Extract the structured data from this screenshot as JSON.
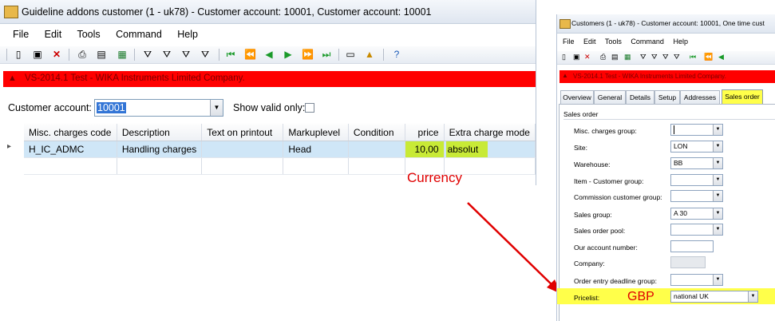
{
  "left_window": {
    "title": "Guideline addons customer (1 - uk78) - Customer account: 10001, Customer account: 10001",
    "menu": [
      "File",
      "Edit",
      "Tools",
      "Command",
      "Help"
    ],
    "banner": "VS-2014.1 Test - WIKA Instruments Limited Company.",
    "customer_account_label": "Customer account:",
    "customer_account_value": "10001",
    "show_valid_only_label": "Show valid only:",
    "table": {
      "columns": [
        "Misc. charges code",
        "Description",
        "Text on printout",
        "Markuplevel",
        "Condition",
        "price",
        "Extra charge mode"
      ],
      "rows": [
        [
          "H_IC_ADMC",
          "Handling charges",
          "",
          "Head",
          "",
          "10,00",
          "absolut"
        ]
      ]
    },
    "annotation": "Currency"
  },
  "right_window": {
    "title": "Customers (1 - uk78) - Customer account: 10001, One time cust",
    "menu": [
      "File",
      "Edit",
      "Tools",
      "Command",
      "Help"
    ],
    "banner": "VS-2014.1 Test - WIKA Instruments Limited Company.",
    "tabs": [
      "Overview",
      "General",
      "Details",
      "Setup",
      "Addresses",
      "Sales order"
    ],
    "group_label": "Sales order",
    "fields": [
      {
        "label": "Misc. charges group:",
        "value": ""
      },
      {
        "label": "Site:",
        "value": "LON"
      },
      {
        "label": "Warehouse:",
        "value": "BB"
      },
      {
        "label": "Item - Customer group:",
        "value": ""
      },
      {
        "label": "Commission customer group:",
        "value": ""
      },
      {
        "label": "Sales group:",
        "value": "A 30"
      },
      {
        "label": "Sales order pool:",
        "value": ""
      },
      {
        "label": "Our account number:",
        "value": ""
      },
      {
        "label": "Company:",
        "value": ""
      },
      {
        "label": "Order entry deadline group:",
        "value": ""
      },
      {
        "label": "Pricelist:",
        "value": "national UK"
      }
    ],
    "annotation": "GBP"
  },
  "colors": {
    "banner": "#ff0000",
    "highlight_yellow": "#ffff4a",
    "highlight_green": "#c8ea36",
    "annotation": "#e00000"
  }
}
